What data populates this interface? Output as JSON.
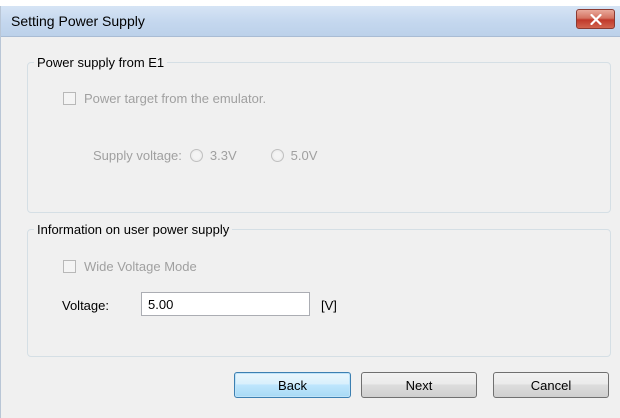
{
  "window": {
    "title": "Setting Power Supply"
  },
  "group_e1": {
    "legend": "Power supply from E1",
    "power_target_label": "Power target from the emulator.",
    "power_target_checked": false,
    "supply_voltage_label": "Supply voltage:",
    "options": [
      {
        "label": "3.3V",
        "selected": false
      },
      {
        "label": "5.0V",
        "selected": false
      }
    ]
  },
  "group_user": {
    "legend": "Information on user power supply",
    "wide_voltage_label": "Wide Voltage Mode",
    "wide_voltage_checked": false,
    "voltage_label": "Voltage:",
    "voltage_value": "5.00",
    "voltage_unit": "[V]"
  },
  "buttons": {
    "back": "Back",
    "next": "Next",
    "cancel": "Cancel"
  },
  "colors": {
    "window_bg": "#f0f0f0",
    "titlebar": "#c4d7ee",
    "close_button": "#c0392b",
    "disabled_text": "#a0a0a0"
  }
}
